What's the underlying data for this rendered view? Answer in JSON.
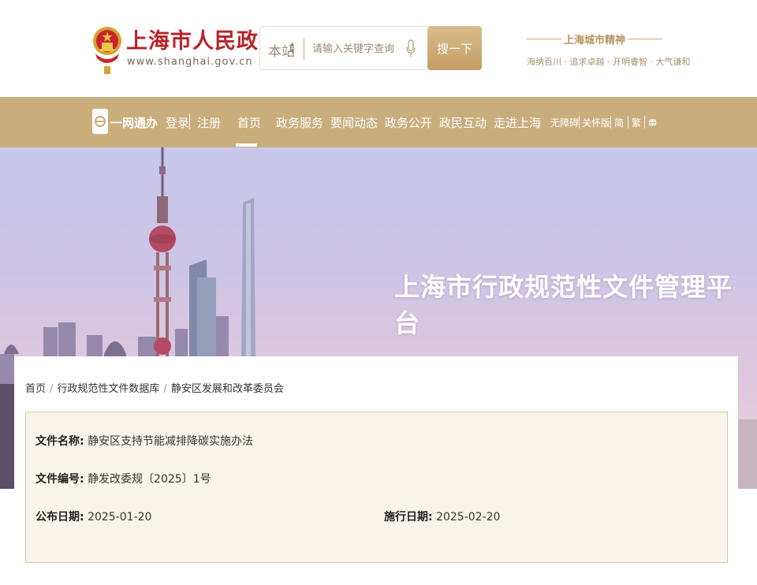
{
  "header": {
    "site_name": "上海市人民政府",
    "site_url": "www.shanghai.gov.cn",
    "search": {
      "scope": "本站",
      "placeholder": "请输入关键字查询",
      "button": "搜一下"
    },
    "spirit": {
      "title": "上海城市精神",
      "text": "海纳百川 · 追求卓越 · 开明睿智 · 大气谦和"
    }
  },
  "nav": {
    "ywtb": "一网通办",
    "login": "登录",
    "register": "注册",
    "items": [
      "首页",
      "政务服务",
      "要闻动态",
      "政务公开",
      "政民互动",
      "走进上海"
    ],
    "active_index": 0,
    "utilities": [
      "无障碍",
      "关怀版",
      "简",
      "繁"
    ]
  },
  "banner": {
    "title": "上海市行政规范性文件管理平台"
  },
  "breadcrumb": [
    "首页",
    "行政规范性文件数据库",
    "静安区发展和改革委员会"
  ],
  "document": {
    "name_label": "文件名称:",
    "name": "静安区支持节能减排降碳实施办法",
    "number_label": "文件编号:",
    "number": "静发改委规〔2025〕1号",
    "publish_label": "公布日期:",
    "publish_date": "2025-01-20",
    "effective_label": "施行日期:",
    "effective_date": "2025-02-20"
  },
  "colors": {
    "brand_red": "#b8232a",
    "nav_gold": "#c9ae7c",
    "button_gold": "#c39e64",
    "info_bg": "#f8f4ea"
  }
}
